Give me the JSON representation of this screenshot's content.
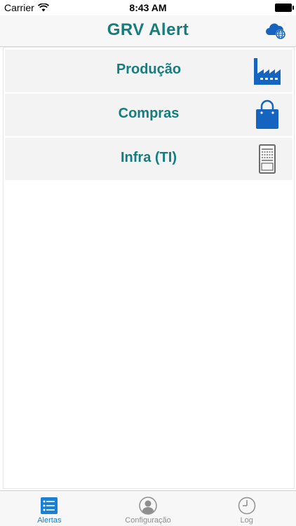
{
  "status_bar": {
    "carrier": "Carrier",
    "time": "8:43 AM"
  },
  "nav_bar": {
    "title": "GRV Alert",
    "action_icon": "cloud-globe-icon"
  },
  "menu": {
    "items": [
      {
        "label": "Produção",
        "icon": "factory-icon"
      },
      {
        "label": "Compras",
        "icon": "shopping-bag-icon"
      },
      {
        "label": "Infra (TI)",
        "icon": "server-icon"
      }
    ]
  },
  "tab_bar": {
    "items": [
      {
        "label": "Alertas",
        "icon": "list-icon",
        "active": true
      },
      {
        "label": "Configuração",
        "icon": "user-icon",
        "active": false
      },
      {
        "label": "Log",
        "icon": "clock-icon",
        "active": false
      }
    ]
  },
  "colors": {
    "accent_text": "#147d7d",
    "icon_blue": "#1565c0",
    "tab_active": "#1a7fd6",
    "tab_inactive": "#8e8e8e"
  }
}
